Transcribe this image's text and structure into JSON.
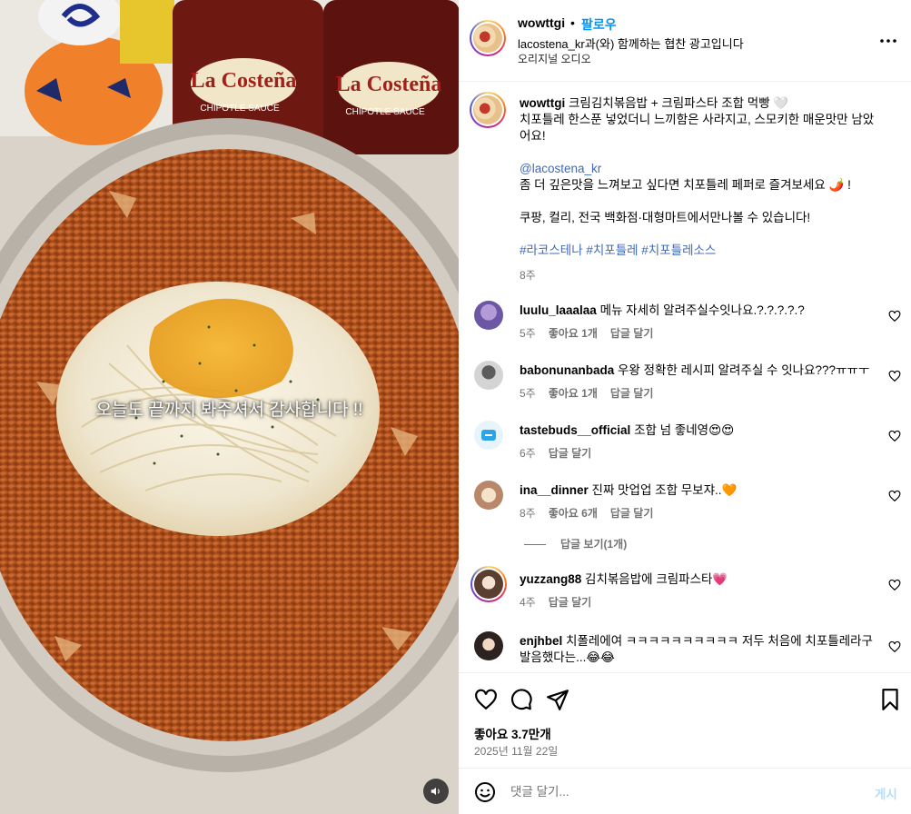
{
  "media": {
    "caption": "오늘도 끝까지 봐주셔서 감사합니다 !!",
    "sauce_brand": "La Costeña",
    "sauce_label": "CHIPOTLE SAUCE"
  },
  "header": {
    "username": "wowttgi",
    "separator": "•",
    "follow_label": "팔로우",
    "partner_text": "lacostena_kr과(와) 함께하는 협찬 광고입니다",
    "audio_text": "오리지널 오디오"
  },
  "post": {
    "username": "wowttgi",
    "line1": "크림김치볶음밥 + 크림파스타 조합 먹빵 🤍",
    "line2": "치포틀레 한스푼 넣었더니 느끼함은 사라지고, 스모키한 매운맛만 남았어요!",
    "mention": "@lacostena_kr",
    "line3": "좀 더 깊은맛을 느껴보고 싶다면 치포틀레 페퍼로 즐겨보세요 🌶️ !",
    "line4": "쿠팡, 컬리, 전국 백화점·대형마트에서만나볼 수 있습니다!",
    "hashtags": "#라코스테나 #치포틀레 #치포틀레소스",
    "age": "8주"
  },
  "comments": [
    {
      "username": "luulu_laaalaa",
      "text": "메뉴 자세히 알려주실수잇나요.?.?.?.?.?",
      "age": "5주",
      "likes": "좋아요 1개",
      "reply": "답글 달기"
    },
    {
      "username": "babonunanbada",
      "text": "우왕 정확한 레시피 알려주실 수 잇나요???ㅠㅠㅜ",
      "age": "5주",
      "likes": "좋아요 1개",
      "reply": "답글 달기"
    },
    {
      "username": "tastebuds__official",
      "text": "조합 넘 좋네영😍😍",
      "age": "6주",
      "likes": "",
      "reply": "답글 달기"
    },
    {
      "username": "ina__dinner",
      "text": "진짜 맛업업 조합 무보쟈..🧡",
      "age": "8주",
      "likes": "좋아요 6개",
      "reply": "답글 달기"
    },
    {
      "username": "yuzzang88",
      "text": "김치볶음밥에 크림파스타💗",
      "age": "4주",
      "likes": "",
      "reply": "답글 달기"
    },
    {
      "username": "enjhbel",
      "text": "치폴레에여 ㅋㅋㅋㅋㅋㅋㅋㅋㅋㅋ 저두 처음에 치포틀레라구 발음했다는...😂😂",
      "age": "",
      "likes": "",
      "reply": ""
    }
  ],
  "view_replies": "답글 보기(1개)",
  "actions": {
    "likes": "좋아요 3.7만개",
    "date": "2025년 11월 22일"
  },
  "composer": {
    "placeholder": "댓글 달기...",
    "post_label": "게시"
  },
  "colors": {
    "link": "#0095f6",
    "hashtag": "#4169b7",
    "muted": "#737373"
  }
}
